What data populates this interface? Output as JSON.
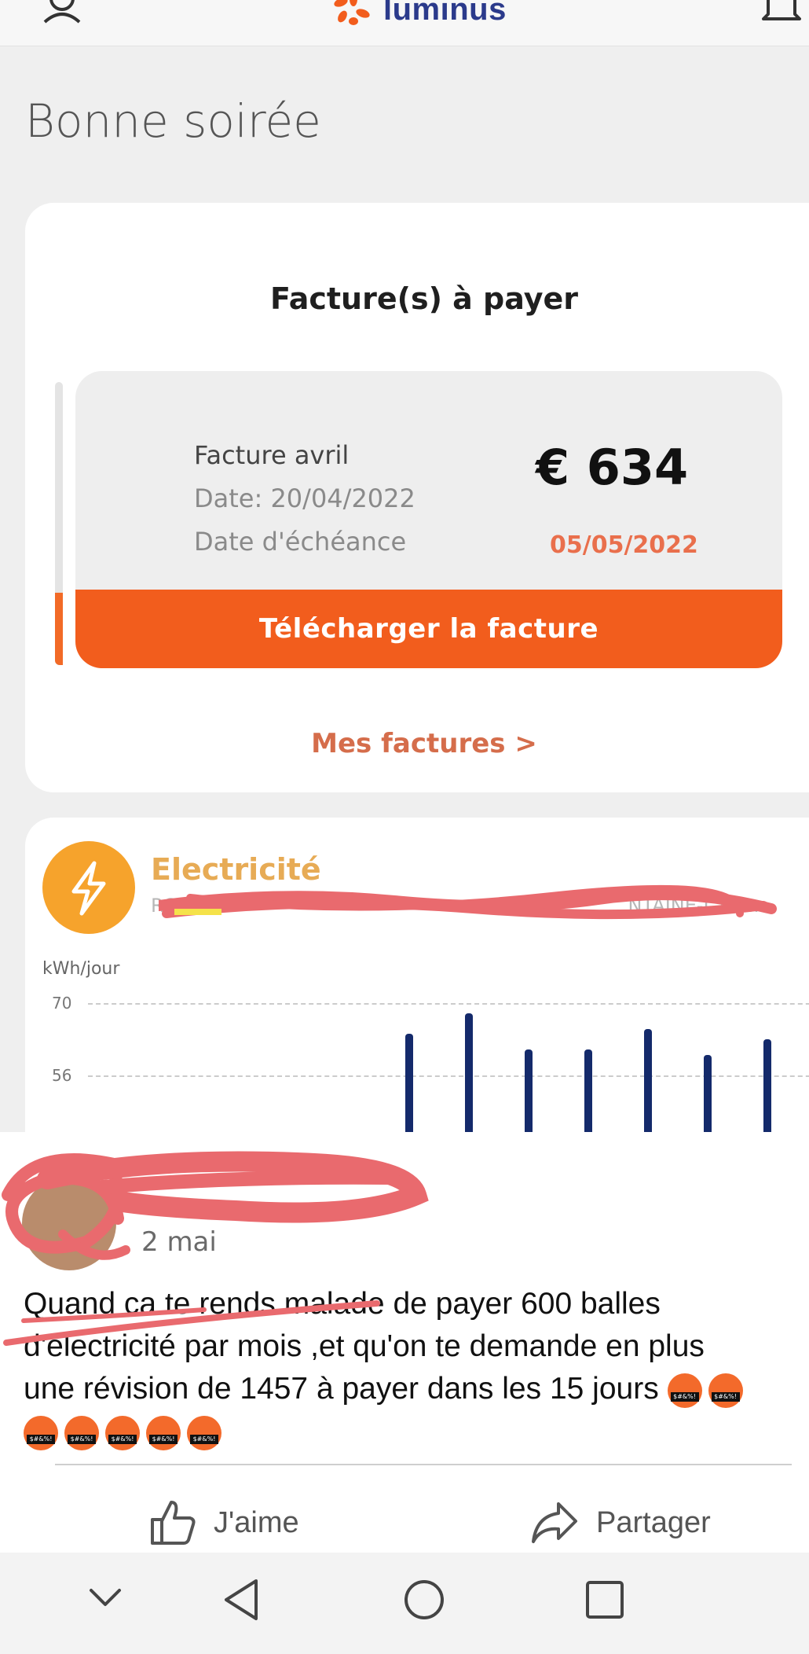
{
  "app": {
    "brand": "luminus",
    "brand_color": "#2b3a8b",
    "accent_color": "#f25d1d",
    "icons": [
      "user-icon",
      "bell-icon"
    ]
  },
  "greeting": "Bonne soirée",
  "invoices": {
    "title": "Facture(s) à payer",
    "item": {
      "name": "Facture avril",
      "date": "Date: 20/04/2022",
      "due_label": "Date d'échéance",
      "amount": "€ 634",
      "due_date": "05/05/2022"
    },
    "download_label": "Télécharger la facture",
    "all_link": "Mes factures >"
  },
  "electricity": {
    "title": "Electricité",
    "address_visible": "RC",
    "address_tail": "NTAINE-L'EV...",
    "unit": "kWh/jour",
    "chart_data": {
      "type": "bar",
      "ylabel": "kWh/jour",
      "y_ticks": [
        "70",
        "56"
      ],
      "values": [
        64,
        68,
        61,
        61,
        65,
        60,
        63
      ]
    }
  },
  "post": {
    "date": "2 mai",
    "text_line1": "Quand ca te rends malade de payer 600 balles",
    "text_line2": "d'électricité par mois ,et qu'on te demande en plus",
    "text_line3": "une révision de 1457 à payer dans les 15 jours",
    "emoji_count": 7,
    "like_label": "J'aime",
    "share_label": "Partager"
  },
  "nav": {
    "icons": [
      "chevron-down-icon",
      "back-icon",
      "home-icon",
      "recents-icon"
    ]
  }
}
